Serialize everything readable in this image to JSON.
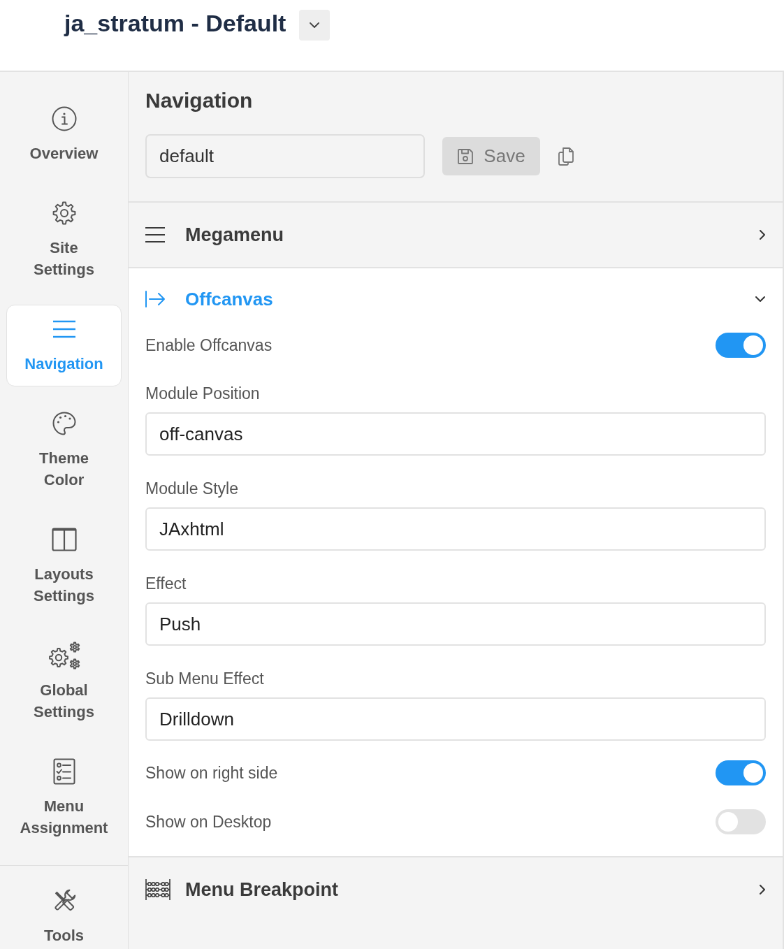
{
  "header": {
    "title": "ja_stratum - Default"
  },
  "sidebar": {
    "items": [
      {
        "label": "Overview",
        "selected": false
      },
      {
        "label": "Site Settings",
        "selected": false
      },
      {
        "label": "Navigation",
        "selected": true
      },
      {
        "label": "Theme Color",
        "selected": false
      },
      {
        "label": "Layouts Settings",
        "selected": false
      },
      {
        "label": "Global Settings",
        "selected": false
      },
      {
        "label": "Menu Assignment",
        "selected": false
      }
    ],
    "footer_items": [
      {
        "label": "Tools",
        "selected": false
      }
    ]
  },
  "panel": {
    "title": "Navigation",
    "name_field": {
      "value": "default"
    },
    "save_button": {
      "label": "Save",
      "disabled": true
    }
  },
  "sections": [
    {
      "title": "Megamenu",
      "expanded": false
    },
    {
      "title": "Offcanvas",
      "expanded": true,
      "settings": [
        {
          "kind": "toggle",
          "label": "Enable Offcanvas",
          "on": true
        },
        {
          "kind": "field",
          "label": "Module Position",
          "value": "off-canvas"
        },
        {
          "kind": "field",
          "label": "Module Style",
          "value": "JAxhtml"
        },
        {
          "kind": "field",
          "label": "Effect",
          "value": "Push"
        },
        {
          "kind": "field",
          "label": "Sub Menu Effect",
          "value": "Drilldown"
        },
        {
          "kind": "toggle",
          "label": "Show on right side",
          "on": true
        },
        {
          "kind": "toggle",
          "label": "Show on Desktop",
          "on": false
        }
      ]
    },
    {
      "title": "Menu Breakpoint",
      "expanded": false
    }
  ]
}
